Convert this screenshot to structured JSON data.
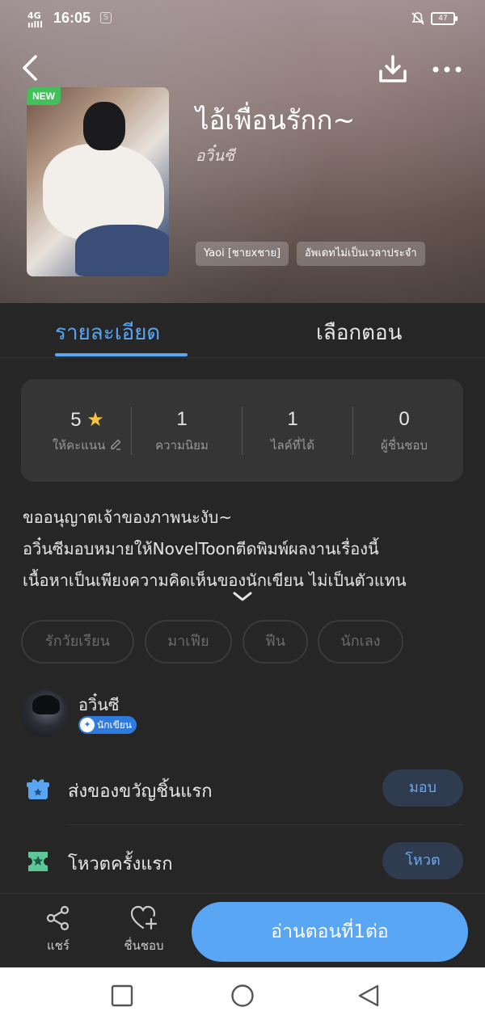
{
  "status_bar": {
    "network": "4G",
    "signal": "ıılll",
    "time": "16:05",
    "s_icon": "S",
    "battery": "47"
  },
  "header": {
    "badge": "NEW",
    "title": "ไอ้เพื่อนรักก~",
    "author": "อวิ๋นซี",
    "tags": [
      "Yaoi [ชายxชาย]",
      "อัพเดทไม่เป็นเวลาประจำ"
    ]
  },
  "tabs": [
    {
      "label": "รายละเอียด",
      "active": true
    },
    {
      "label": "เลือกตอน",
      "active": false
    }
  ],
  "stats": [
    {
      "value": "5",
      "label": "ให้คะแนน",
      "icon": "star-icon",
      "extra_icon": "edit-pencil-icon"
    },
    {
      "value": "1",
      "label": "ความนิยม"
    },
    {
      "value": "1",
      "label": "ไลค์ที่ได้"
    },
    {
      "value": "0",
      "label": "ผู้ชื่นชอบ"
    }
  ],
  "description": [
    "ขออนุญาตเจ้าของภาพนะงับ~",
    "อวิ๋นซีมอบหมายให้NovelToonตีดพิมพ์ผลงานเรื่องนี้",
    "เนื้อหาเป็นเพียงความคิดเห็นของนักเขียน ไม่เป็นตัวแทน"
  ],
  "genres": [
    "รักวัยเรียน",
    "มาเฟีย",
    "ฟีน",
    "นักเลง"
  ],
  "author_section": {
    "name": "อวิ๋นซี",
    "badge": "นักเขียน"
  },
  "actions": [
    {
      "label": "ส่งของขวัญชิ้นแรก",
      "button": "มอบ",
      "icon": "gift-icon",
      "icon_color": "#5aa4f2"
    },
    {
      "label": "โหวตครั้งแรก",
      "button": "โหวต",
      "icon": "ticket-icon",
      "icon_color": "#5cc89a"
    }
  ],
  "bottom_bar": {
    "share": "แชร์",
    "favorite": "ชื่นชอบ",
    "read": "อ่านตอนที่1ต่อ"
  },
  "colors": {
    "accent": "#58a6f4",
    "background": "#262626",
    "new_badge": "#43c05a"
  }
}
